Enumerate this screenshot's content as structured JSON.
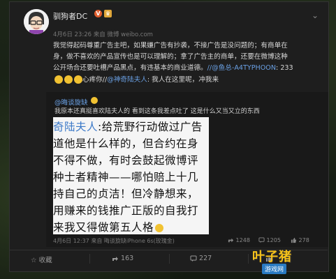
{
  "post": {
    "username": "驯狗者DC",
    "badge_v": "V",
    "meta": "4月6日 23:26 来自 微博 weibo.com",
    "body_lines": [
      "我觉得起码尊重广告主吧，如果嫌广告有抄袭，不接广告是没问题的；有商单在",
      "身，做不喜欢的产品宣传也是可以理解的；拿了广告主的商单，还要在微博这种",
      "公开场合还要吐槽产品黑点，有违基本的商业道德。"
    ],
    "body_line3_link": "//@鱼总-A4TYPHOON",
    "body_line3_suffix": ": 233",
    "body_line4_prefix": "心疼你//",
    "body_line4_link": "@神奇陆夫人",
    "body_line4_suffix": ": 我人在这里呢，冲我来"
  },
  "retweet": {
    "name": "@晦谈旋缺",
    "text": "我原本还真挺喜欢陆夫人的 看到这条我差点吐了 这是什么又当又立的东西",
    "image_lines": [
      {
        "blue": "奇陆夫人",
        "rest": ":给荒野行动做过广告"
      },
      {
        "blue": "",
        "rest": "道他是什么样的，但合约在身"
      },
      {
        "blue": "",
        "rest": "不得不做，有时会鼓起微博评"
      },
      {
        "blue": "",
        "rest": "种士者精神——哪怕赔上十几"
      },
      {
        "blue": "",
        "rest": "持自己的贞洁！但冷静想来，"
      },
      {
        "blue": "",
        "rest": "用赚来的钱推广正版的自我打"
      },
      {
        "blue": "",
        "rest": "来我又得做第五人格"
      }
    ],
    "meta": "4月6日 12:37 来自 晦谈旋缺iPhone 6s(玫瑰金)",
    "share_count": "1248",
    "comment_count": "1205",
    "like_count": "278"
  },
  "actions": {
    "favorite": "收藏",
    "share_count": "163",
    "comment_count": "227",
    "like_count": ""
  },
  "watermark": {
    "title": "叶子猪",
    "url": "游戏网"
  },
  "colors": {
    "link": "#6aa0e4",
    "card_bg": "#1e1e1e",
    "retweet_bg": "#191919",
    "text": "#d8d8d8"
  },
  "icons": [
    "more-icon",
    "share-icon",
    "comment-icon",
    "like-icon",
    "favorite-icon",
    "v-badge-icon",
    "crown-badge-icon"
  ]
}
